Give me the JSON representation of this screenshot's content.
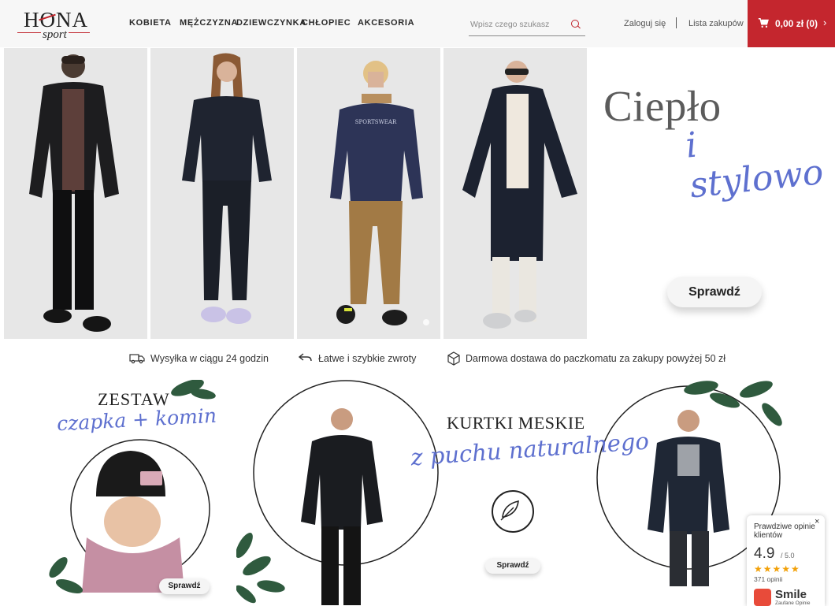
{
  "header": {
    "logo": {
      "brand": "HONA",
      "sub": "sport"
    },
    "nav": [
      "KOBIETA",
      "MĘŻCZYZNA",
      "DZIEWCZYNKA",
      "CHŁOPIEC",
      "AKCESORIA"
    ],
    "search": {
      "placeholder": "Wpisz czego szukasz",
      "icon": "search-icon"
    },
    "login_label": "Zaloguj się",
    "wishlist_label": "Lista zakupów",
    "cart": {
      "total": "0,00 zł (0)",
      "icon": "cart-icon",
      "color": "#c4262e"
    }
  },
  "hero": {
    "title": "Ciepło",
    "subtitle": "i stylowo",
    "button": "Sprawdź",
    "accent": "#5e70cf"
  },
  "features": [
    {
      "icon": "truck-icon",
      "text": "Wysyłka w ciągu 24 godzin"
    },
    {
      "icon": "return-arrow-icon",
      "text": "Łatwe i szybkie zwroty"
    },
    {
      "icon": "package-icon",
      "text": "Darmowa dostawa do paczkomatu za zakupy powyżej 50 zł"
    }
  ],
  "promo_set": {
    "title": "ZESTAW",
    "subtitle": "czapka + komin",
    "button": "Sprawdź"
  },
  "promo_jackets": {
    "title": "KURTKI MESKIE",
    "subtitle": "z puchu naturalnego",
    "icon": "feather-icon",
    "button": "Sprawdź"
  },
  "reviews": {
    "title": "Prawdziwe opinie klientów",
    "close": "×",
    "score": "4.9",
    "max": "/ 5.0",
    "rating": 4.9,
    "count": "371 opinii",
    "brand": "Smile",
    "brand_sub": "Zaufane Opinie"
  }
}
